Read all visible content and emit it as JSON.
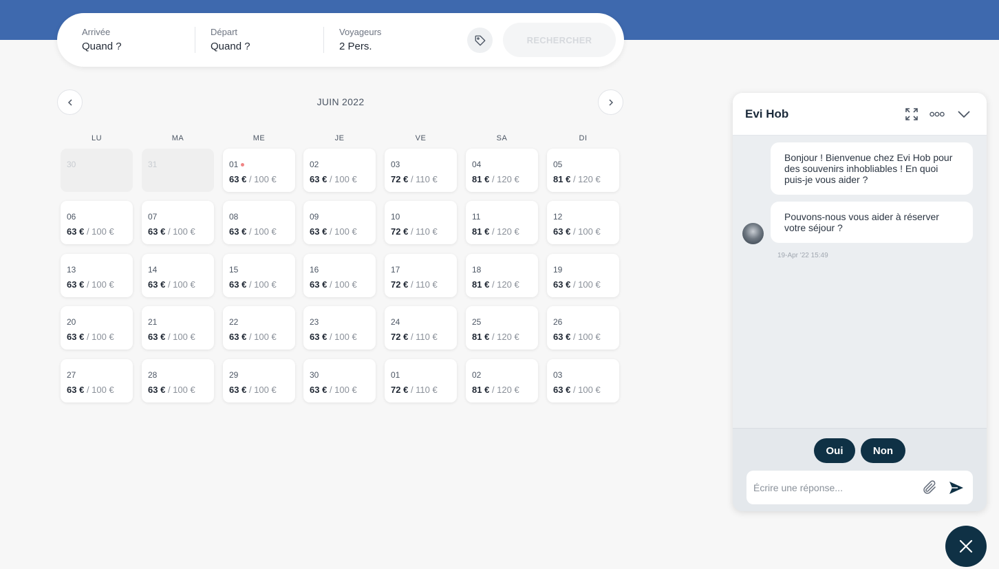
{
  "search": {
    "arrival_label": "Arrivée",
    "arrival_value": "Quand ?",
    "departure_label": "Départ",
    "departure_value": "Quand ?",
    "travelers_label": "Voyageurs",
    "travelers_value": "2 Pers.",
    "search_button": "RECHERCHER",
    "promo_icon": "tag-icon"
  },
  "calendar": {
    "month_title": "JUIN 2022",
    "weekdays": [
      "LU",
      "MA",
      "ME",
      "JE",
      "VE",
      "SA",
      "DI"
    ],
    "weeks": [
      [
        {
          "day": "30",
          "past": true
        },
        {
          "day": "31",
          "past": true
        },
        {
          "day": "01",
          "price": "63 €",
          "orig": "/ 100 €",
          "today": true
        },
        {
          "day": "02",
          "price": "63 €",
          "orig": "/ 100 €"
        },
        {
          "day": "03",
          "price": "72 €",
          "orig": "/ 110 €"
        },
        {
          "day": "04",
          "price": "81 €",
          "orig": "/ 120 €"
        },
        {
          "day": "05",
          "price": "81 €",
          "orig": "/ 120 €"
        }
      ],
      [
        {
          "day": "06",
          "price": "63 €",
          "orig": "/ 100 €"
        },
        {
          "day": "07",
          "price": "63 €",
          "orig": "/ 100 €"
        },
        {
          "day": "08",
          "price": "63 €",
          "orig": "/ 100 €"
        },
        {
          "day": "09",
          "price": "63 €",
          "orig": "/ 100 €"
        },
        {
          "day": "10",
          "price": "72 €",
          "orig": "/ 110 €"
        },
        {
          "day": "11",
          "price": "81 €",
          "orig": "/ 120 €"
        },
        {
          "day": "12",
          "price": "63 €",
          "orig": "/ 100 €"
        }
      ],
      [
        {
          "day": "13",
          "price": "63 €",
          "orig": "/ 100 €"
        },
        {
          "day": "14",
          "price": "63 €",
          "orig": "/ 100 €"
        },
        {
          "day": "15",
          "price": "63 €",
          "orig": "/ 100 €"
        },
        {
          "day": "16",
          "price": "63 €",
          "orig": "/ 100 €"
        },
        {
          "day": "17",
          "price": "72 €",
          "orig": "/ 110 €"
        },
        {
          "day": "18",
          "price": "81 €",
          "orig": "/ 120 €"
        },
        {
          "day": "19",
          "price": "63 €",
          "orig": "/ 100 €"
        }
      ],
      [
        {
          "day": "20",
          "price": "63 €",
          "orig": "/ 100 €"
        },
        {
          "day": "21",
          "price": "63 €",
          "orig": "/ 100 €"
        },
        {
          "day": "22",
          "price": "63 €",
          "orig": "/ 100 €"
        },
        {
          "day": "23",
          "price": "63 €",
          "orig": "/ 100 €"
        },
        {
          "day": "24",
          "price": "72 €",
          "orig": "/ 110 €"
        },
        {
          "day": "25",
          "price": "81 €",
          "orig": "/ 120 €"
        },
        {
          "day": "26",
          "price": "63 €",
          "orig": "/ 100 €"
        }
      ],
      [
        {
          "day": "27",
          "price": "63 €",
          "orig": "/ 100 €"
        },
        {
          "day": "28",
          "price": "63 €",
          "orig": "/ 100 €"
        },
        {
          "day": "29",
          "price": "63 €",
          "orig": "/ 100 €"
        },
        {
          "day": "30",
          "price": "63 €",
          "orig": "/ 100 €"
        },
        {
          "day": "01",
          "price": "72 €",
          "orig": "/ 110 €"
        },
        {
          "day": "02",
          "price": "81 €",
          "orig": "/ 120 €"
        },
        {
          "day": "03",
          "price": "63 €",
          "orig": "/ 100 €"
        }
      ]
    ]
  },
  "chat": {
    "title": "Evi Hob",
    "messages": [
      "Bonjour ! Bienvenue chez Evi Hob pour des souvenirs inhobliables ! En quoi puis-je vous aider ?",
      "Pouvons-nous vous aider à réserver votre séjour ?"
    ],
    "timestamp": "19-Apr '22 15:49",
    "quick_replies": [
      "Oui",
      "Non"
    ],
    "input_placeholder": "Écrire une réponse..."
  },
  "colors": {
    "topbar": "#3e69ae",
    "dark_navy": "#0f3145",
    "today_dot": "#f08585"
  }
}
